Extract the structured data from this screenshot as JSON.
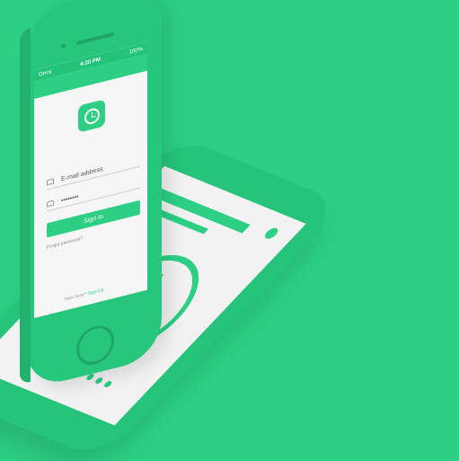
{
  "status": {
    "carrier": "Omni",
    "time": "4:20 PM",
    "battery": "100%"
  },
  "login": {
    "email_placeholder": "E-mail address",
    "password_mask": "••••••••",
    "signin_label": "Sign In",
    "forgot": "Forgot password?",
    "new_here": "New here?",
    "signup": "Sign Up"
  },
  "colors": {
    "accent": "#2ccf84",
    "background": "#2ccf84"
  },
  "icons": {
    "app": "clock-icon",
    "email": "envelope-icon",
    "password": "lock-icon",
    "feature": "tie-icon"
  }
}
